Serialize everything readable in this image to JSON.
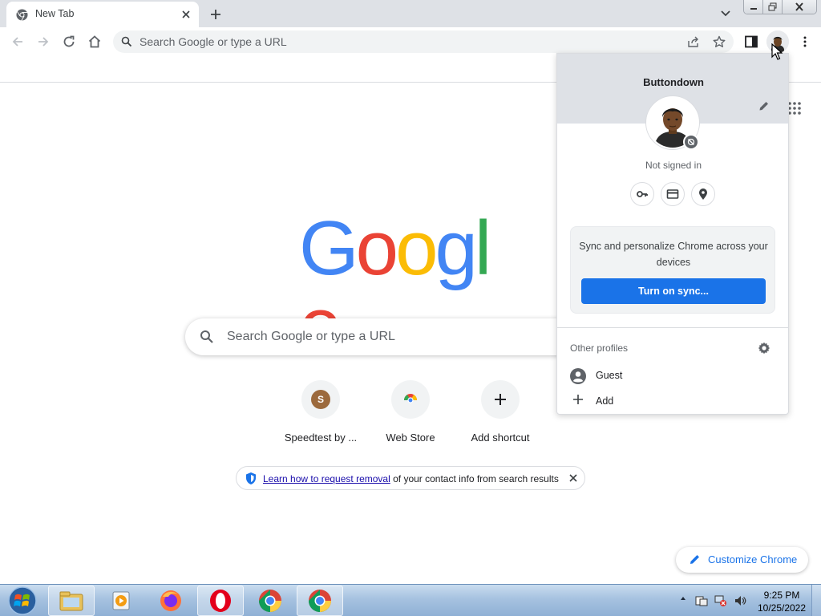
{
  "tab": {
    "title": "New Tab",
    "favicon": "chrome-icon"
  },
  "toolbar": {
    "omnibox_placeholder": "Search Google or type a URL",
    "icons": [
      "back-icon",
      "forward-icon",
      "reload-icon",
      "home-icon",
      "share-icon",
      "star-icon",
      "side-panel-icon",
      "profile-avatar",
      "kebab-menu-icon"
    ]
  },
  "ntp": {
    "logo": [
      "G",
      "o",
      "o",
      "g",
      "l",
      "e"
    ],
    "logo_colors": [
      "#4285f4",
      "#ea4335",
      "#fbbc05",
      "#4285f4",
      "#34a853",
      "#ea4335"
    ],
    "search_placeholder": "Search Google or type a URL",
    "shortcuts": [
      {
        "label": "Speedtest by ...",
        "icon_letter": "S",
        "icon_color": "#9c6a3d"
      },
      {
        "label": "Web Store",
        "icon": "webstore-icon"
      },
      {
        "label": "Add shortcut",
        "icon": "plus-icon"
      }
    ],
    "promo": {
      "link_text": "Learn how to request removal",
      "rest_text": " of your contact info from search results"
    },
    "customize_label": "Customize Chrome"
  },
  "profile_menu": {
    "name": "Buttondown",
    "status": "Not signed in",
    "quick_actions": [
      "key-icon",
      "credit-card-icon",
      "location-pin-icon"
    ],
    "sync_text": "Sync and personalize Chrome across your devices",
    "sync_button": "Turn on sync...",
    "other_profiles_label": "Other profiles",
    "rows": [
      {
        "label": "Guest",
        "icon": "guest-icon"
      },
      {
        "label": "Add",
        "icon": "plus-icon"
      }
    ]
  },
  "taskbar": {
    "apps": [
      "file-explorer-icon",
      "media-player-icon",
      "firefox-icon",
      "opera-icon",
      "chrome-icon",
      "chrome-icon"
    ],
    "time": "9:25 PM",
    "date": "10/25/2022"
  },
  "colors": {
    "accent": "#1a73e8",
    "tabstrip": "#dee1e6"
  }
}
